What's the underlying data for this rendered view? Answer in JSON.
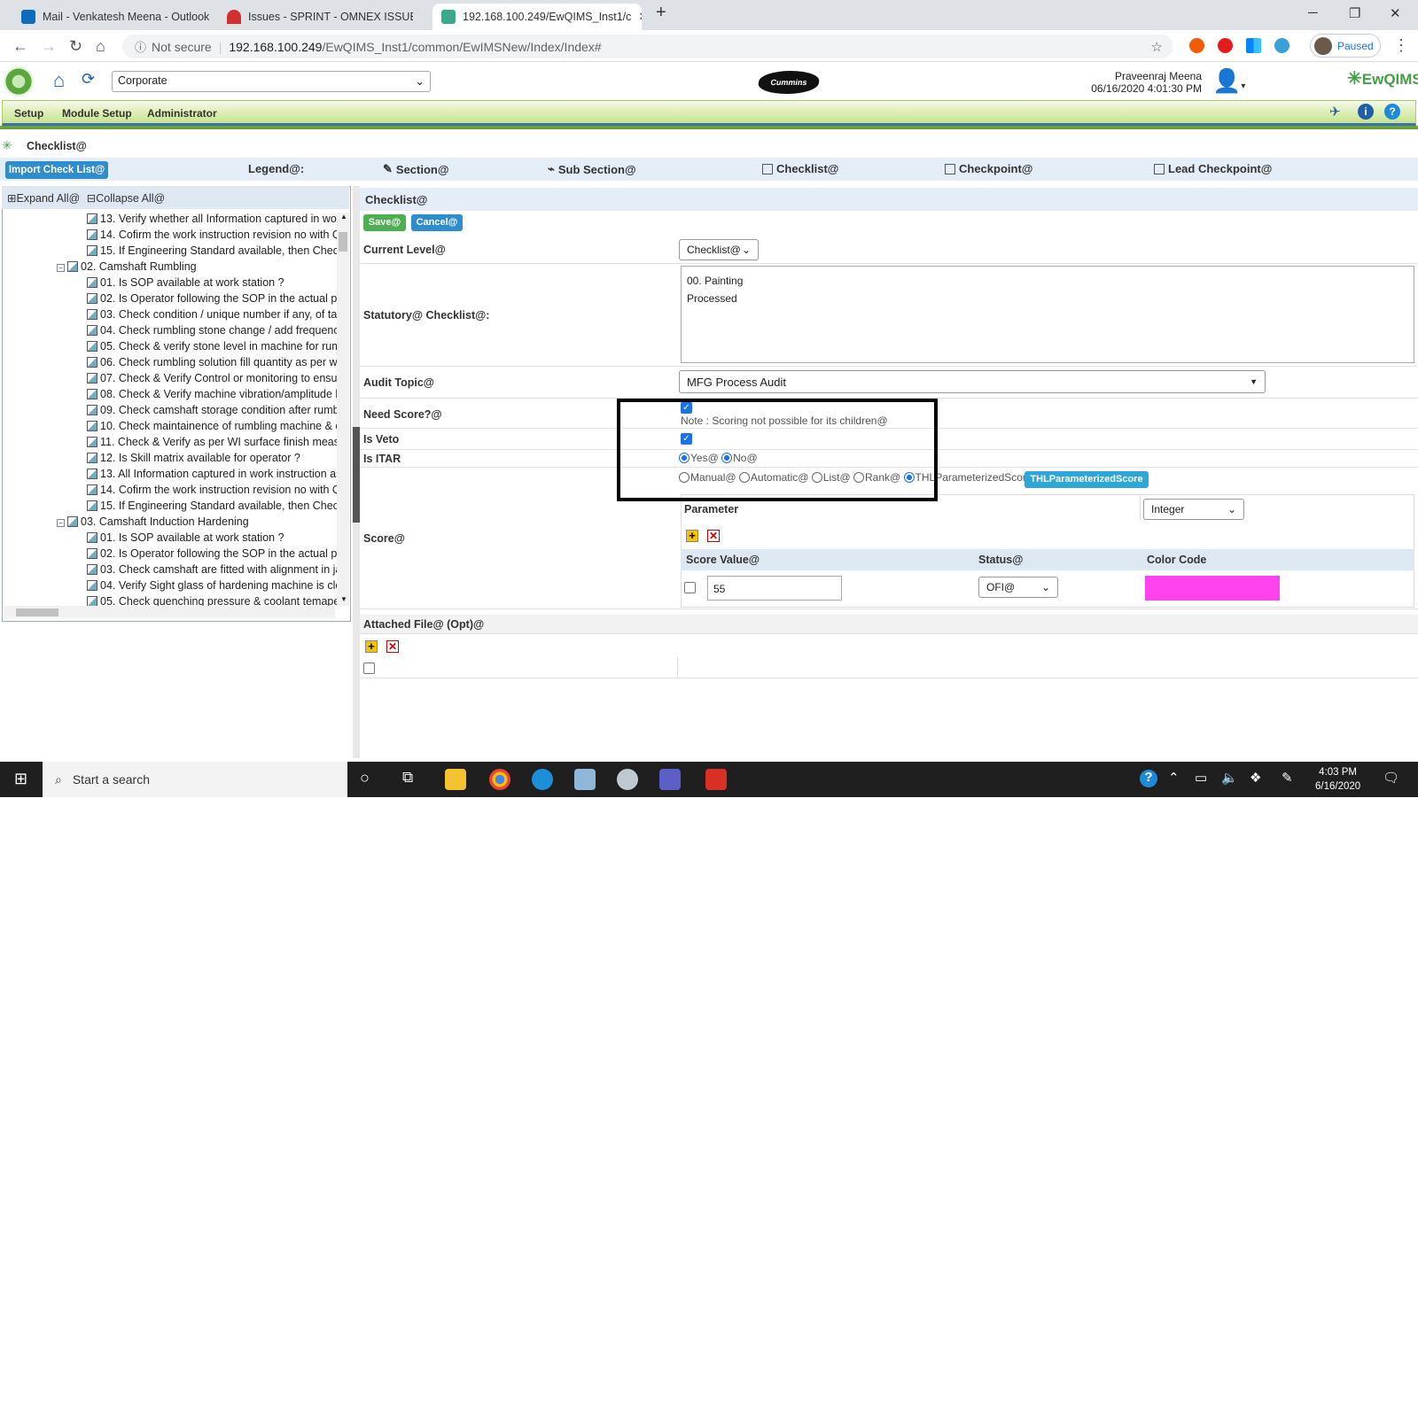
{
  "browser": {
    "tabs": [
      {
        "title": "Mail - Venkatesh Meena - Outlook"
      },
      {
        "title": "Issues - SPRINT - OMNEX ISSUE"
      },
      {
        "title": "192.168.100.249/EwQIMS_Inst1/c"
      }
    ],
    "not_secure": "Not secure",
    "url_host": "192.168.100.249",
    "url_path": "/EwQIMS_Inst1/common/EwIMSNew/Index/Index#",
    "profile_status": "Paused"
  },
  "header": {
    "site_select": "Corporate",
    "brand_logo_text": "Cummins",
    "user_name": "Praveenraj Meena",
    "datetime": "06/16/2020 4:01:30 PM",
    "app_logo": "EwQIMS"
  },
  "menu": [
    "Setup",
    "Module Setup",
    "Administrator"
  ],
  "breadcrumb": "Checklist@",
  "toolbar": {
    "import_button": "Import Check List@",
    "legend_label": "Legend@:",
    "legend_items": [
      "Section@",
      "Sub Section@",
      "Checklist@",
      "Checkpoint@",
      "Lead Checkpoint@"
    ]
  },
  "tree": {
    "expand_all": "Expand All@",
    "collapse_all": "Collapse All@",
    "nodes": [
      {
        "text": "13. Verify whether all Information captured in wor",
        "level": 2
      },
      {
        "text": "14. Cofirm the work instruction revision no with Q",
        "level": 2
      },
      {
        "text": "15. If Engineering Standard available, then Check",
        "level": 2
      },
      {
        "text": "02. Camshaft Rumbling",
        "level": 1
      },
      {
        "text": "01. Is SOP available at work station ?",
        "level": 2
      },
      {
        "text": "02. Is Operator following the SOP in the actual pro",
        "level": 2
      },
      {
        "text": "03. Check condition / unique number if any, of tac",
        "level": 2
      },
      {
        "text": "04. Check rumbling stone change / add frequency,",
        "level": 2
      },
      {
        "text": "05. Check & verify stone level in machine for rumb",
        "level": 2
      },
      {
        "text": "06. Check rumbling solution fill quantity as per wo",
        "level": 2
      },
      {
        "text": "07. Check & Verify Control or monitoring to ensure",
        "level": 2
      },
      {
        "text": "08. Check & Verify machine vibration/amplitude le",
        "level": 2
      },
      {
        "text": "09. Check camshaft storage condition after rumbli",
        "level": 2
      },
      {
        "text": "10. Check maintainence of rumbling machine & co",
        "level": 2
      },
      {
        "text": "11. Check & Verify as per WI surface finish measu",
        "level": 2
      },
      {
        "text": "12. Is Skill matrix available for operator ?",
        "level": 2
      },
      {
        "text": "13. All Information captured in work instruction as",
        "level": 2
      },
      {
        "text": "14. Cofirm the work instruction revision no with Q",
        "level": 2
      },
      {
        "text": "15. If Engineering Standard available, then Check",
        "level": 2
      },
      {
        "text": "03. Camshaft Induction Hardening",
        "level": 1
      },
      {
        "text": "01. Is SOP available at work station ?",
        "level": 2
      },
      {
        "text": "02. Is Operator following the SOP in the actual pro",
        "level": 2
      },
      {
        "text": "03. Check camshaft are fitted with alignment in ja",
        "level": 2
      },
      {
        "text": "04. Verify Sight glass of hardening machine is clea",
        "level": 2
      },
      {
        "text": "05. Check quenching pressure & coolant temapera",
        "level": 2
      }
    ]
  },
  "form": {
    "title": "Checklist@",
    "save": "Save@",
    "cancel": "Cancel@",
    "current_level_label": "Current Level@",
    "current_level_value": "Checklist@",
    "statutory_label": "Statutory@ Checklist@:",
    "statutory_line1": "00. Painting",
    "statutory_line2": "Processed",
    "audit_topic_label": "Audit Topic@",
    "audit_topic_value": "MFG Process Audit",
    "need_score_label": "Need Score?@",
    "need_score_checked": true,
    "need_score_note": "Note : Scoring not possible for its children@",
    "is_veto_label": "Is Veto",
    "is_veto_checked": true,
    "is_itar_label": "Is ITAR",
    "itar_yes": "Yes@",
    "itar_no": "No@",
    "itar_selected": "No@",
    "score_label": "Score@",
    "score_types": [
      "Manual@",
      "Automatic@",
      "List@",
      "Rank@",
      "THLParameterizedScore"
    ],
    "score_type_selected": "THLParameterizedScore",
    "score_type_button": "THLParameterizedScore",
    "parameter_label": "Parameter",
    "parameter_type": "Integer",
    "col_score_value": "Score Value@",
    "col_status": "Status@",
    "col_color": "Color Code",
    "row_score_value": "55",
    "row_status": "OFI@",
    "row_color": "#ff44ee",
    "attached_label": "Attached File@ (Opt)@"
  },
  "taskbar": {
    "search_placeholder": "Start a search",
    "time": "4:03 PM",
    "date": "6/16/2020"
  },
  "colors": {
    "menu_green": "#c6e389",
    "accent_blue": "#2f8dcb",
    "save_green": "#4caf50",
    "highlight_box": "#000000"
  }
}
